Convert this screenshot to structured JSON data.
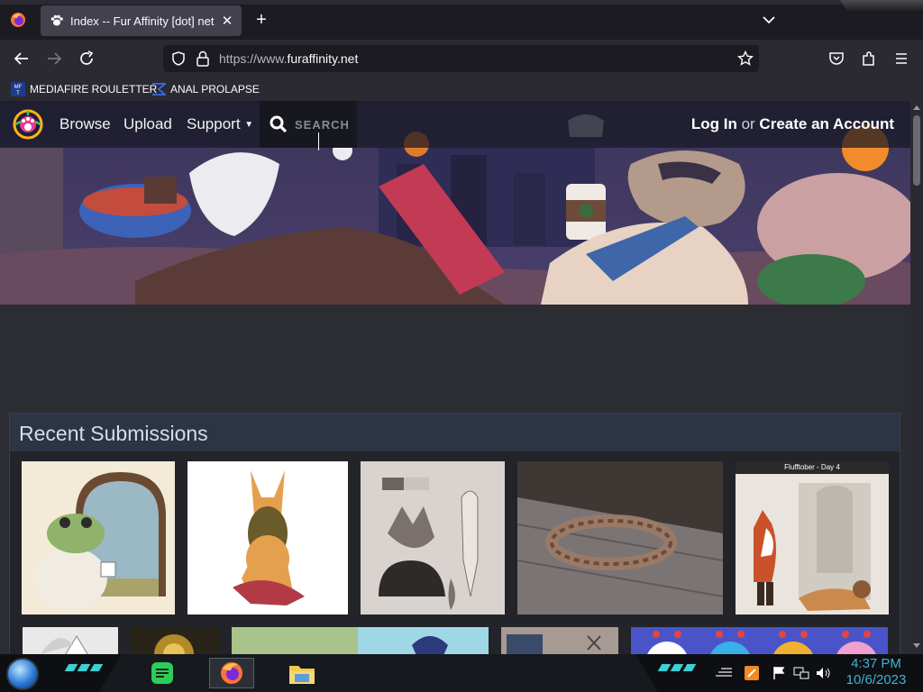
{
  "browser": {
    "tab_title": "Index -- Fur Affinity [dot] net",
    "tab_close": "✕",
    "new_tab": "+",
    "url_scheme": "https://www.",
    "url_host": "furaffinity.net"
  },
  "bookmarks": [
    {
      "label": "MEDIAFIRE ROULETTER",
      "icon": "mediafire-icon"
    },
    {
      "label": "ANAL PROLAPSE",
      "icon": "bookmark-logo-icon"
    }
  ],
  "site": {
    "nav": [
      "Browse",
      "Upload",
      "Support"
    ],
    "search_placeholder": "SEARCH",
    "login": "Log In",
    "or": "or",
    "create": "Create an Account"
  },
  "recent": {
    "title": "Recent Submissions",
    "thumbs": [
      {
        "name": "frog-in-sweater",
        "bg": "#f3ead8"
      },
      {
        "name": "dog-character",
        "bg": "#ffffff"
      },
      {
        "name": "wolf-reference-sheet",
        "bg": "#d9d3cf"
      },
      {
        "name": "copper-bracelet",
        "bg": "#5c5653"
      },
      {
        "name": "flufftober-day-4",
        "bg": "#e9e5de",
        "caption": "Flufftober - Day 4"
      }
    ]
  },
  "taskbar": {
    "time": "4:37 PM",
    "date": "10/6/2023",
    "accent": "#3dcfd3"
  }
}
